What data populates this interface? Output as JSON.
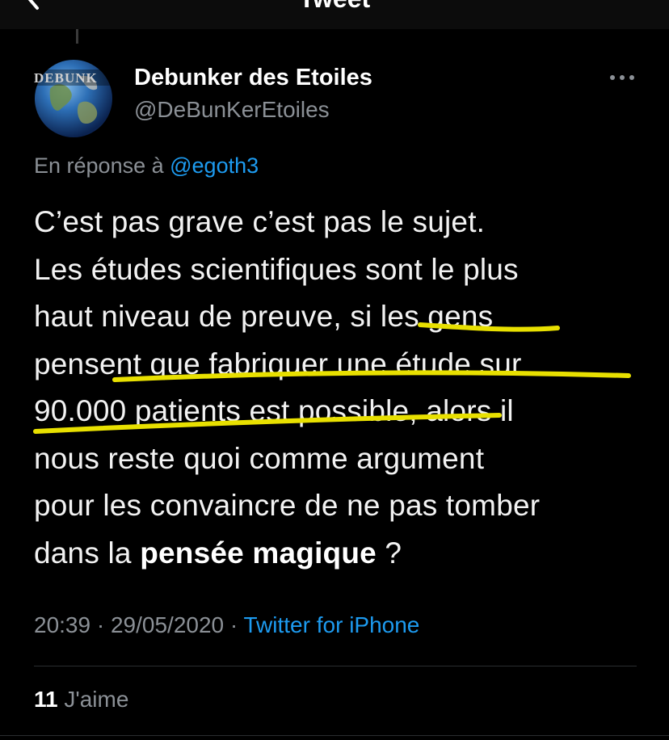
{
  "header": {
    "title": "Tweet",
    "back_icon": "chevron-left-icon"
  },
  "author": {
    "avatar_logo_text": "DEBUNK",
    "name": "Debunker des Etoiles",
    "handle": "@DeBunKerEtoiles",
    "more_icon": "more-horizontal-icon"
  },
  "reply": {
    "prefix": "En réponse à ",
    "to_handle": "@egoth3"
  },
  "tweet": {
    "lines": [
      "C’est pas grave c’est pas le sujet.",
      "Les études scientifiques sont le plus",
      "haut niveau de preuve, si les gens",
      "pensent que fabriquer une étude sur",
      "90.000 patients est possible, alors il",
      "nous reste quoi comme argument",
      "pour les convaincre de ne pas tomber"
    ],
    "last_line_before": "dans la ",
    "last_line_bold": "pensée magique",
    "last_line_after": " ?",
    "highlight_color": "#e8e000"
  },
  "meta": {
    "time": "20:39",
    "date": "29/05/2020",
    "separator": " · ",
    "source": "Twitter for iPhone"
  },
  "likes": {
    "count": "11",
    "label": " J'aime"
  },
  "colors": {
    "background": "#000000",
    "text": "#e7e9ea",
    "muted": "#8b9096",
    "link": "#1d9bf0"
  }
}
